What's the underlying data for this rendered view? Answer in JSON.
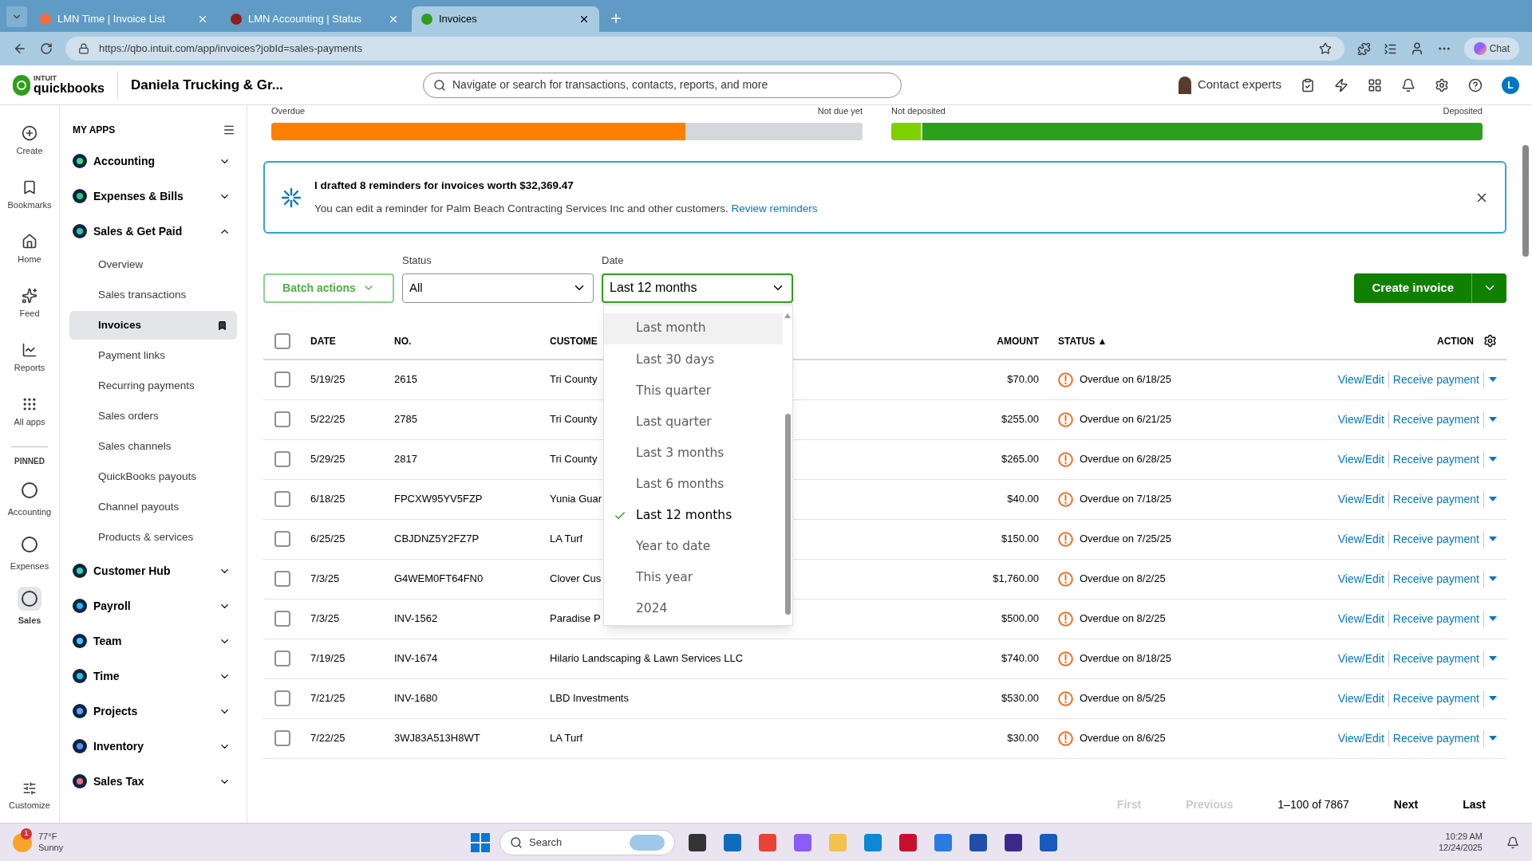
{
  "browser": {
    "tabs": [
      {
        "title": "LMN Time | Invoice List",
        "selected": false
      },
      {
        "title": "LMN Accounting | Status",
        "selected": false
      },
      {
        "title": "Invoices",
        "selected": true
      }
    ],
    "url": "https://qbo.intuit.com/app/invoices?jobId=sales-payments",
    "chat": "Chat"
  },
  "header": {
    "logo_top": "INTUIT",
    "logo_bottom": "quickbooks",
    "company": "Daniela Trucking & Gr...",
    "search_placeholder": "Navigate or search for transactions, contacts, reports, and more",
    "contact_experts": "Contact experts",
    "avatar": "L"
  },
  "rail": {
    "items": [
      {
        "label": "Create",
        "selected": false
      },
      {
        "label": "Bookmarks",
        "selected": false
      },
      {
        "label": "Home",
        "selected": false
      },
      {
        "label": "Feed",
        "selected": false
      },
      {
        "label": "Reports",
        "selected": false
      },
      {
        "label": "All apps",
        "selected": false
      }
    ],
    "pinned_label": "PINNED",
    "pinned": [
      {
        "label": "Accounting",
        "selected": false
      },
      {
        "label": "Expenses",
        "selected": false
      },
      {
        "label": "Sales",
        "selected": true
      }
    ],
    "customize": "Customize"
  },
  "sidebar": {
    "heading": "MY APPS",
    "apps": [
      {
        "label": "Accounting",
        "color": "#3ddc84",
        "expanded": false
      },
      {
        "label": "Expenses & Bills",
        "color": "#2ecc71",
        "expanded": false
      },
      {
        "label": "Sales & Get Paid",
        "color": "#37c5a0",
        "expanded": true,
        "children": [
          {
            "label": "Overview",
            "selected": false
          },
          {
            "label": "Sales transactions",
            "selected": false
          },
          {
            "label": "Invoices",
            "selected": true
          },
          {
            "label": "Payment links",
            "selected": false
          },
          {
            "label": "Recurring payments",
            "selected": false
          },
          {
            "label": "Sales orders",
            "selected": false
          },
          {
            "label": "Sales channels",
            "selected": false
          },
          {
            "label": "QuickBooks payouts",
            "selected": false
          },
          {
            "label": "Channel payouts",
            "selected": false
          },
          {
            "label": "Products & services",
            "selected": false
          }
        ]
      },
      {
        "label": "Customer Hub",
        "color": "#2fd5a8",
        "expanded": false
      },
      {
        "label": "Payroll",
        "color": "#29b6f6",
        "expanded": false
      },
      {
        "label": "Team",
        "color": "#4fc3f7",
        "expanded": false
      },
      {
        "label": "Time",
        "color": "#26c6da",
        "expanded": false
      },
      {
        "label": "Projects",
        "color": "#64a0f0",
        "expanded": false
      },
      {
        "label": "Inventory",
        "color": "#5c8df6",
        "expanded": false
      },
      {
        "label": "Sales Tax",
        "color": "#f26b7a",
        "expanded": false
      }
    ]
  },
  "summary": {
    "bars": [
      {
        "left_label": "Overdue",
        "right_label": "Not due yet",
        "level": 0.7,
        "color": "#ff8000"
      },
      {
        "left_label": "Not deposited",
        "right_label": "Deposited",
        "level": 0.05,
        "color": "#7fd000"
      }
    ]
  },
  "banner": {
    "title": "I drafted 8 reminders for invoices worth $32,369.47",
    "text": "You can edit a reminder for Palm Beach Contracting Services Inc and other customers.",
    "link": "Review reminders"
  },
  "filters": {
    "batch_actions": "Batch actions",
    "status": {
      "label": "Status",
      "value": "All"
    },
    "date": {
      "label": "Date",
      "value": "Last 12 months"
    },
    "create_invoice": "Create invoice"
  },
  "date_menu": {
    "options": [
      {
        "label": "Last month",
        "selected": false,
        "hovered": true
      },
      {
        "label": "Last 30 days",
        "selected": false,
        "hovered": false
      },
      {
        "label": "This quarter",
        "selected": false,
        "hovered": false
      },
      {
        "label": "Last quarter",
        "selected": false,
        "hovered": false
      },
      {
        "label": "Last 3 months",
        "selected": false,
        "hovered": false
      },
      {
        "label": "Last 6 months",
        "selected": false,
        "hovered": false
      },
      {
        "label": "Last 12 months",
        "selected": true,
        "hovered": false
      },
      {
        "label": "Year to date",
        "selected": false,
        "hovered": false
      },
      {
        "label": "This year",
        "selected": false,
        "hovered": false
      },
      {
        "label": "2024",
        "selected": false,
        "hovered": false
      }
    ]
  },
  "table": {
    "all_checked": false,
    "columns": {
      "date": "DATE",
      "no": "NO.",
      "customer": "CUSTOME",
      "amount": "AMOUNT",
      "status": "STATUS ▲",
      "action": "ACTION"
    },
    "rows": [
      {
        "checked": false,
        "date": "5/19/25",
        "no": "2615",
        "customer": "Tri County",
        "amount": "$70.00",
        "status": "Overdue on 6/18/25",
        "actions": [
          "View/Edit",
          "Receive payment"
        ]
      },
      {
        "checked": false,
        "date": "5/22/25",
        "no": "2785",
        "customer": "Tri County",
        "amount": "$255.00",
        "status": "Overdue on 6/21/25",
        "actions": [
          "View/Edit",
          "Receive payment"
        ]
      },
      {
        "checked": false,
        "date": "5/29/25",
        "no": "2817",
        "customer": "Tri County",
        "amount": "$265.00",
        "status": "Overdue on 6/28/25",
        "actions": [
          "View/Edit",
          "Receive payment"
        ]
      },
      {
        "checked": false,
        "date": "6/18/25",
        "no": "FPCXW95YV5FZP",
        "customer": "Yunia Guar",
        "amount": "$40.00",
        "status": "Overdue on 7/18/25",
        "actions": [
          "View/Edit",
          "Receive payment"
        ]
      },
      {
        "checked": false,
        "date": "6/25/25",
        "no": "CBJDNZ5Y2FZ7P",
        "customer": "LA Turf",
        "amount": "$150.00",
        "status": "Overdue on 7/25/25",
        "actions": [
          "View/Edit",
          "Receive payment"
        ]
      },
      {
        "checked": false,
        "date": "7/3/25",
        "no": "G4WEM0FT64FN0",
        "customer": "Clover Cus",
        "amount": "$1,760.00",
        "status": "Overdue on 8/2/25",
        "actions": [
          "View/Edit",
          "Receive payment"
        ]
      },
      {
        "checked": false,
        "date": "7/3/25",
        "no": "INV-1562",
        "customer": "Paradise P",
        "amount": "$500.00",
        "status": "Overdue on 8/2/25",
        "actions": [
          "View/Edit",
          "Receive payment"
        ]
      },
      {
        "checked": false,
        "date": "7/19/25",
        "no": "INV-1674",
        "customer": "Hilario Landscaping & Lawn Services LLC",
        "amount": "$740.00",
        "status": "Overdue on 8/18/25",
        "actions": [
          "View/Edit",
          "Receive payment"
        ]
      },
      {
        "checked": false,
        "date": "7/21/25",
        "no": "INV-1680",
        "customer": "LBD Investments",
        "amount": "$530.00",
        "status": "Overdue on 8/5/25",
        "actions": [
          "View/Edit",
          "Receive payment"
        ]
      },
      {
        "checked": false,
        "date": "7/22/25",
        "no": "3WJ83A513H8WT",
        "customer": "LA Turf",
        "amount": "$30.00",
        "status": "Overdue on 8/6/25",
        "actions": [
          "View/Edit",
          "Receive payment"
        ]
      }
    ]
  },
  "pagination": {
    "first": {
      "label": "First",
      "disabled": true
    },
    "previous": {
      "label": "Previous",
      "disabled": true
    },
    "range": "1–100 of 7867",
    "next": {
      "label": "Next",
      "disabled": false
    },
    "last": {
      "label": "Last",
      "disabled": false
    }
  },
  "taskbar": {
    "temperature": "77°F",
    "condition": "Sunny",
    "badge": "1",
    "search": "Search",
    "time": "10:29 AM",
    "date": "12/24/2025"
  }
}
